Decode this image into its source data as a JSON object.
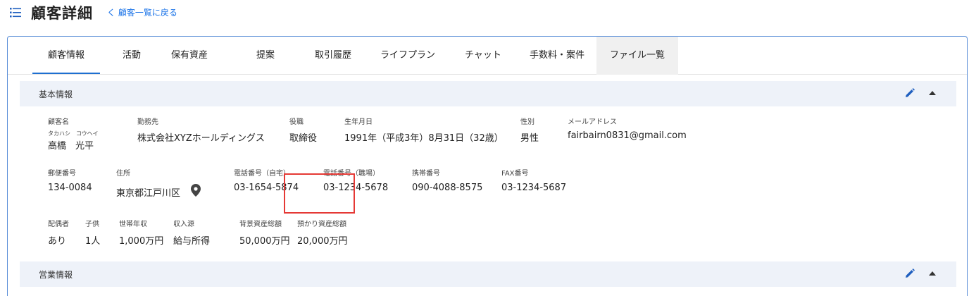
{
  "header": {
    "title": "顧客詳細",
    "back_link": "く 顧客一覧に戻る"
  },
  "tabs": [
    {
      "label": "顧客情報"
    },
    {
      "label": "活動"
    },
    {
      "label": "保有資産"
    },
    {
      "label": "提案"
    },
    {
      "label": "取引履歴"
    },
    {
      "label": "ライフプラン"
    },
    {
      "label": "チャット"
    },
    {
      "label": "手数料・案件"
    },
    {
      "label": "ファイル一覧"
    }
  ],
  "active_tab": "顧客情報",
  "basic_info": {
    "title": "基本情報",
    "customer_name": {
      "label": "顧客名",
      "kana": "タカハシ　コウヘイ",
      "value": "高橋　光平"
    },
    "employer": {
      "label": "勤務先",
      "value": "株式会社XYZホールディングス"
    },
    "position": {
      "label": "役職",
      "value": "取締役"
    },
    "birthdate": {
      "label": "生年月日",
      "value": "1991年（平成3年）8月31日（32歳）"
    },
    "gender": {
      "label": "性別",
      "value": "男性"
    },
    "email": {
      "label": "メールアドレス",
      "value": "fairbairn0831@gmail.com"
    },
    "postal_code": {
      "label": "郵便番号",
      "value": "134-0084"
    },
    "address": {
      "label": "住所",
      "value": "東京都江戸川区"
    },
    "phone_home": {
      "label": "電話番号（自宅）",
      "value": "03-1654-5874"
    },
    "phone_work": {
      "label": "電話番号（職場）",
      "value": "03-1234-5678"
    },
    "mobile": {
      "label": "携帯番号",
      "value": "090-4088-8575"
    },
    "fax": {
      "label": "FAX番号",
      "value": "03-1234-5687"
    },
    "spouse": {
      "label": "配偶者",
      "value": "あり"
    },
    "children": {
      "label": "子供",
      "value": "1人"
    },
    "household_income": {
      "label": "世帯年収",
      "value": "1,000万円"
    },
    "income_source": {
      "label": "収入源",
      "value": "給与所得"
    },
    "background_assets": {
      "label": "背景資産総額",
      "value": "50,000万円"
    },
    "deposited_assets": {
      "label": "預かり資産総額",
      "value": "20,000万円"
    }
  },
  "sales_info": {
    "title": "営業情報"
  },
  "colors": {
    "accent": "#1e6fd0",
    "section_bg": "#eef2f9",
    "highlight": "#e53935",
    "icon": "#1f5fbf"
  },
  "icons": [
    "list-icon",
    "pencil-icon",
    "caret-up-icon",
    "location-pin-icon"
  ]
}
